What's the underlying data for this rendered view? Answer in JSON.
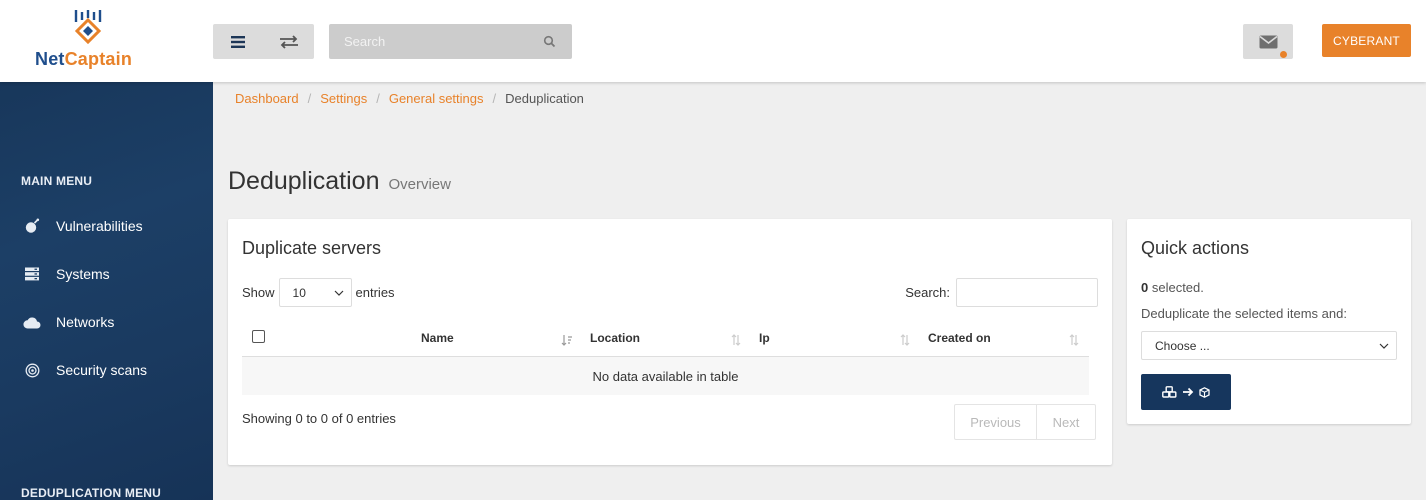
{
  "brand": {
    "name_part1": "Net",
    "name_part2": "Captain",
    "logo_icon": "netcaptain-logo",
    "colors": {
      "navy": "#16365d",
      "orange": "#e8822a"
    }
  },
  "header": {
    "menu_icon": "hamburger-menu-icon",
    "swap_icon": "swap-arrows-icon",
    "search_placeholder": "Search",
    "search_icon": "search-icon",
    "mail_icon": "envelope-icon",
    "user_label": "CYBERANT"
  },
  "sidebar": {
    "main_menu_heading": "MAIN MENU",
    "items": [
      {
        "label": "Vulnerabilities",
        "icon": "bomb-icon"
      },
      {
        "label": "Systems",
        "icon": "server-icon"
      },
      {
        "label": "Networks",
        "icon": "cloud-icon"
      },
      {
        "label": "Security scans",
        "icon": "target-icon"
      }
    ],
    "dedup_menu_heading": "DEDUPLICATION MENU"
  },
  "breadcrumb": {
    "items": [
      "Dashboard",
      "Settings",
      "General settings"
    ],
    "current": "Deduplication"
  },
  "page": {
    "title": "Deduplication",
    "subtitle": "Overview"
  },
  "duplicates": {
    "title": "Duplicate servers",
    "show_label": "Show",
    "length_value": "10",
    "entries_label": "entries",
    "search_label": "Search:",
    "columns": [
      "Name",
      "Location",
      "Ip",
      "Created on"
    ],
    "empty_text": "No data available in table",
    "info_text": "Showing 0 to 0 of 0 entries",
    "previous_label": "Previous",
    "next_label": "Next"
  },
  "quick_actions": {
    "title": "Quick actions",
    "selected_count": "0",
    "selected_suffix": " selected.",
    "description": "Deduplicate the selected items and:",
    "select_value": "Choose ...",
    "action_icon": "merge-cubes-icon"
  }
}
